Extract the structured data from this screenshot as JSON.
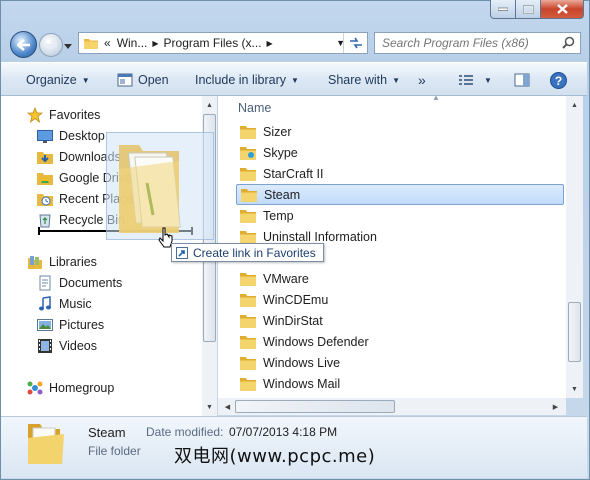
{
  "window": {
    "caption_buttons": [
      "minimize",
      "maximize",
      "close"
    ]
  },
  "address_bar": {
    "overflow_chevron": "«",
    "crumbs": [
      "Win...",
      "Program Files (x..."
    ],
    "separator": "▶"
  },
  "search": {
    "placeholder": "Search Program Files (x86)"
  },
  "command_bar": {
    "organize": "Organize",
    "open": "Open",
    "include_in_library": "Include in library",
    "share_with": "Share with",
    "more": "»"
  },
  "nav_pane": {
    "favorites_header": "Favorites",
    "favorites": [
      "Desktop",
      "Downloads",
      "Google Drive",
      "Recent Places",
      "Recycle Bin"
    ],
    "libraries_header": "Libraries",
    "libraries": [
      "Documents",
      "Music",
      "Pictures",
      "Videos"
    ],
    "homegroup": "Homegroup"
  },
  "file_list": {
    "column_name": "Name",
    "items": [
      "Sizer",
      "Skype",
      "StarCraft II",
      "Steam",
      "Temp",
      "Uninstall Information",
      "VMware",
      "WinCDEmu",
      "WinDirStat",
      "Windows Defender",
      "Windows Live",
      "Windows Mail"
    ],
    "selected": "Steam"
  },
  "drag_tooltip": {
    "text": "Create link in Favorites"
  },
  "details": {
    "name": "Steam",
    "type": "File folder",
    "modified_label": "Date modified:",
    "modified_value": "07/07/2013 4:18 PM"
  },
  "watermark": "双电网(www.pcpc.me)",
  "colors": {
    "accent": "#1e395b",
    "selection": "#c1dbfc",
    "folder": "#f0c94f"
  }
}
